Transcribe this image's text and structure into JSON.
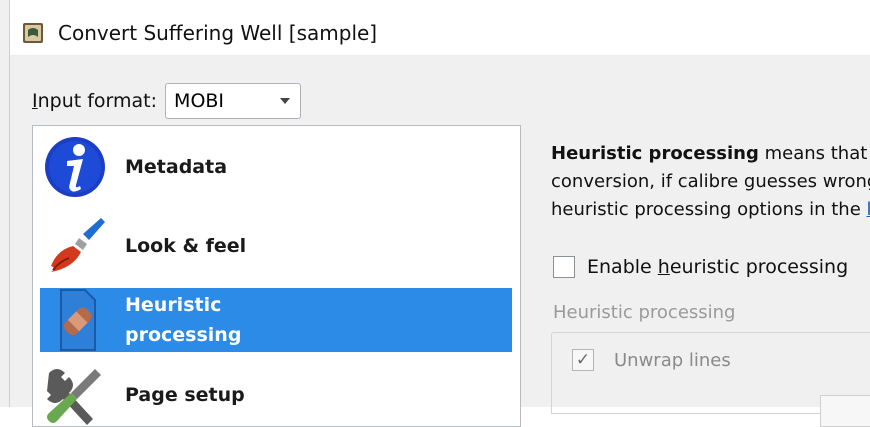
{
  "window": {
    "title": "Convert Suffering Well [sample]",
    "icon": "calibre-book-icon"
  },
  "input_format": {
    "label_prefix": "I",
    "label_rest": "nput format:",
    "selected_value": "MOBI"
  },
  "sidebar": {
    "items": [
      {
        "label": "Metadata",
        "icon": "info-icon"
      },
      {
        "label": "Look & feel",
        "icon": "paintbrush-icon"
      },
      {
        "label_line1": "Heuristic",
        "label_line2": "processing",
        "icon": "bandage-icon",
        "selected": true
      },
      {
        "label": "Page setup",
        "icon": "tools-icon"
      }
    ]
  },
  "panel": {
    "desc_bold": "Heuristic processing",
    "desc_line1_rest": " means that c",
    "desc_line2": "conversion, if calibre guesses wrong",
    "desc_line3": "heuristic processing options in the ",
    "desc_link_fragment": "l",
    "enable_prefix": "Enable ",
    "enable_underlined": "h",
    "enable_rest": "euristic processing",
    "group_title": "Heuristic processing",
    "unwrap_label": "Unwrap lines",
    "unwrap_checked": true
  },
  "colors": {
    "selection": "#2b8be6",
    "background": "#f0f0f0",
    "link": "#1a5fb4"
  }
}
